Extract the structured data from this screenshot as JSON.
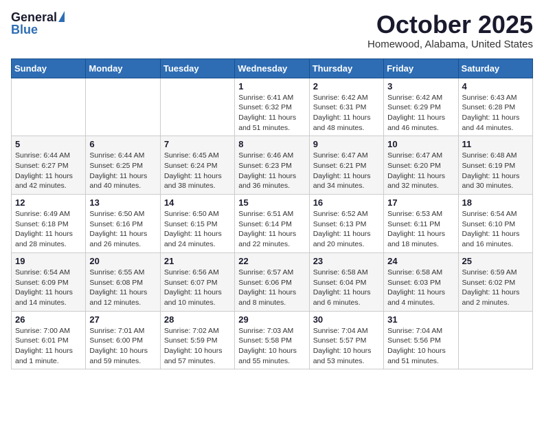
{
  "logo": {
    "general": "General",
    "blue": "Blue"
  },
  "header": {
    "month": "October 2025",
    "location": "Homewood, Alabama, United States"
  },
  "days_of_week": [
    "Sunday",
    "Monday",
    "Tuesday",
    "Wednesday",
    "Thursday",
    "Friday",
    "Saturday"
  ],
  "weeks": [
    [
      {
        "day": "",
        "content": ""
      },
      {
        "day": "",
        "content": ""
      },
      {
        "day": "",
        "content": ""
      },
      {
        "day": "1",
        "content": "Sunrise: 6:41 AM\nSunset: 6:32 PM\nDaylight: 11 hours and 51 minutes."
      },
      {
        "day": "2",
        "content": "Sunrise: 6:42 AM\nSunset: 6:31 PM\nDaylight: 11 hours and 48 minutes."
      },
      {
        "day": "3",
        "content": "Sunrise: 6:42 AM\nSunset: 6:29 PM\nDaylight: 11 hours and 46 minutes."
      },
      {
        "day": "4",
        "content": "Sunrise: 6:43 AM\nSunset: 6:28 PM\nDaylight: 11 hours and 44 minutes."
      }
    ],
    [
      {
        "day": "5",
        "content": "Sunrise: 6:44 AM\nSunset: 6:27 PM\nDaylight: 11 hours and 42 minutes."
      },
      {
        "day": "6",
        "content": "Sunrise: 6:44 AM\nSunset: 6:25 PM\nDaylight: 11 hours and 40 minutes."
      },
      {
        "day": "7",
        "content": "Sunrise: 6:45 AM\nSunset: 6:24 PM\nDaylight: 11 hours and 38 minutes."
      },
      {
        "day": "8",
        "content": "Sunrise: 6:46 AM\nSunset: 6:23 PM\nDaylight: 11 hours and 36 minutes."
      },
      {
        "day": "9",
        "content": "Sunrise: 6:47 AM\nSunset: 6:21 PM\nDaylight: 11 hours and 34 minutes."
      },
      {
        "day": "10",
        "content": "Sunrise: 6:47 AM\nSunset: 6:20 PM\nDaylight: 11 hours and 32 minutes."
      },
      {
        "day": "11",
        "content": "Sunrise: 6:48 AM\nSunset: 6:19 PM\nDaylight: 11 hours and 30 minutes."
      }
    ],
    [
      {
        "day": "12",
        "content": "Sunrise: 6:49 AM\nSunset: 6:18 PM\nDaylight: 11 hours and 28 minutes."
      },
      {
        "day": "13",
        "content": "Sunrise: 6:50 AM\nSunset: 6:16 PM\nDaylight: 11 hours and 26 minutes."
      },
      {
        "day": "14",
        "content": "Sunrise: 6:50 AM\nSunset: 6:15 PM\nDaylight: 11 hours and 24 minutes."
      },
      {
        "day": "15",
        "content": "Sunrise: 6:51 AM\nSunset: 6:14 PM\nDaylight: 11 hours and 22 minutes."
      },
      {
        "day": "16",
        "content": "Sunrise: 6:52 AM\nSunset: 6:13 PM\nDaylight: 11 hours and 20 minutes."
      },
      {
        "day": "17",
        "content": "Sunrise: 6:53 AM\nSunset: 6:11 PM\nDaylight: 11 hours and 18 minutes."
      },
      {
        "day": "18",
        "content": "Sunrise: 6:54 AM\nSunset: 6:10 PM\nDaylight: 11 hours and 16 minutes."
      }
    ],
    [
      {
        "day": "19",
        "content": "Sunrise: 6:54 AM\nSunset: 6:09 PM\nDaylight: 11 hours and 14 minutes."
      },
      {
        "day": "20",
        "content": "Sunrise: 6:55 AM\nSunset: 6:08 PM\nDaylight: 11 hours and 12 minutes."
      },
      {
        "day": "21",
        "content": "Sunrise: 6:56 AM\nSunset: 6:07 PM\nDaylight: 11 hours and 10 minutes."
      },
      {
        "day": "22",
        "content": "Sunrise: 6:57 AM\nSunset: 6:06 PM\nDaylight: 11 hours and 8 minutes."
      },
      {
        "day": "23",
        "content": "Sunrise: 6:58 AM\nSunset: 6:04 PM\nDaylight: 11 hours and 6 minutes."
      },
      {
        "day": "24",
        "content": "Sunrise: 6:58 AM\nSunset: 6:03 PM\nDaylight: 11 hours and 4 minutes."
      },
      {
        "day": "25",
        "content": "Sunrise: 6:59 AM\nSunset: 6:02 PM\nDaylight: 11 hours and 2 minutes."
      }
    ],
    [
      {
        "day": "26",
        "content": "Sunrise: 7:00 AM\nSunset: 6:01 PM\nDaylight: 11 hours and 1 minute."
      },
      {
        "day": "27",
        "content": "Sunrise: 7:01 AM\nSunset: 6:00 PM\nDaylight: 10 hours and 59 minutes."
      },
      {
        "day": "28",
        "content": "Sunrise: 7:02 AM\nSunset: 5:59 PM\nDaylight: 10 hours and 57 minutes."
      },
      {
        "day": "29",
        "content": "Sunrise: 7:03 AM\nSunset: 5:58 PM\nDaylight: 10 hours and 55 minutes."
      },
      {
        "day": "30",
        "content": "Sunrise: 7:04 AM\nSunset: 5:57 PM\nDaylight: 10 hours and 53 minutes."
      },
      {
        "day": "31",
        "content": "Sunrise: 7:04 AM\nSunset: 5:56 PM\nDaylight: 10 hours and 51 minutes."
      },
      {
        "day": "",
        "content": ""
      }
    ]
  ]
}
